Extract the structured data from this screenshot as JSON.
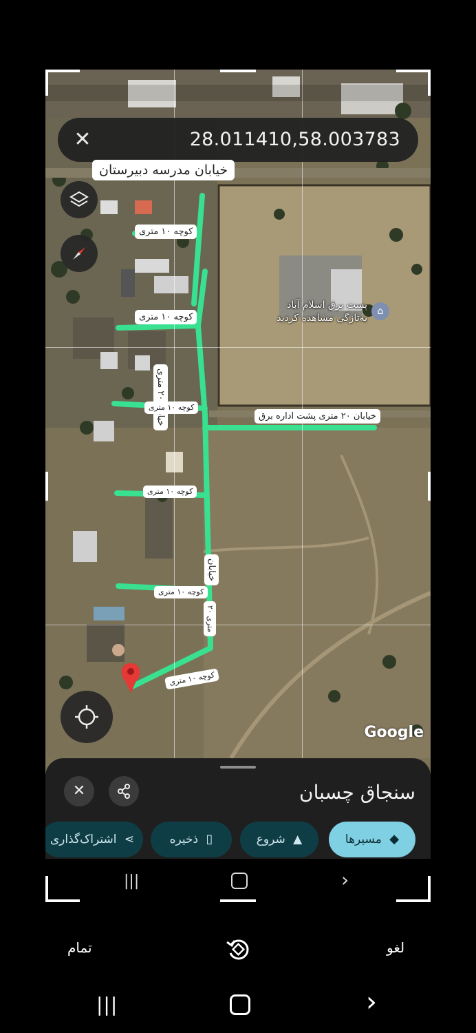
{
  "map": {
    "coordinates": "28.011410,58.003783",
    "attribution": "Google",
    "labels": {
      "school_street": "خیابان مدرسه دبیرستان",
      "alley_1": "کوچه ۱۰ متری",
      "alley_2": "کوچه ۱۰ متری",
      "vertical_street_1": "خیابان ۲۰ متری",
      "alley_3": "کوچه ۱۰ متری",
      "street_behind": "خیابان ۲۰ متری پشت اداره برق",
      "alley_4": "کوچه ۱۰ متری",
      "vertical_street_2a": "خیابان",
      "alley_5": "کوچه ۱۰ متری",
      "vertical_street_2b": "۲۰ متری",
      "alley_6": "کوچه ۱۰ متری"
    },
    "poi": {
      "name": "پست برق اسلام آباد",
      "subtitle": "به‌تازگی مشاهده کردید"
    },
    "icons": [
      "layers-icon",
      "compass-icon",
      "my-location-icon",
      "red-pin-icon"
    ]
  },
  "sheet": {
    "title": "سنجاق چسبان",
    "chips": {
      "directions": "مسیرها",
      "start": "شروع",
      "save": "ذخیره",
      "share": "اشتراک‌گذاری"
    }
  },
  "editor": {
    "cancel": "لغو",
    "done": "تمام"
  },
  "colors": {
    "accent_chip": "#7fd0e3",
    "dark_chip": "#0f3d46",
    "drawn_route": "#38e08f",
    "pin": "#e53935"
  }
}
